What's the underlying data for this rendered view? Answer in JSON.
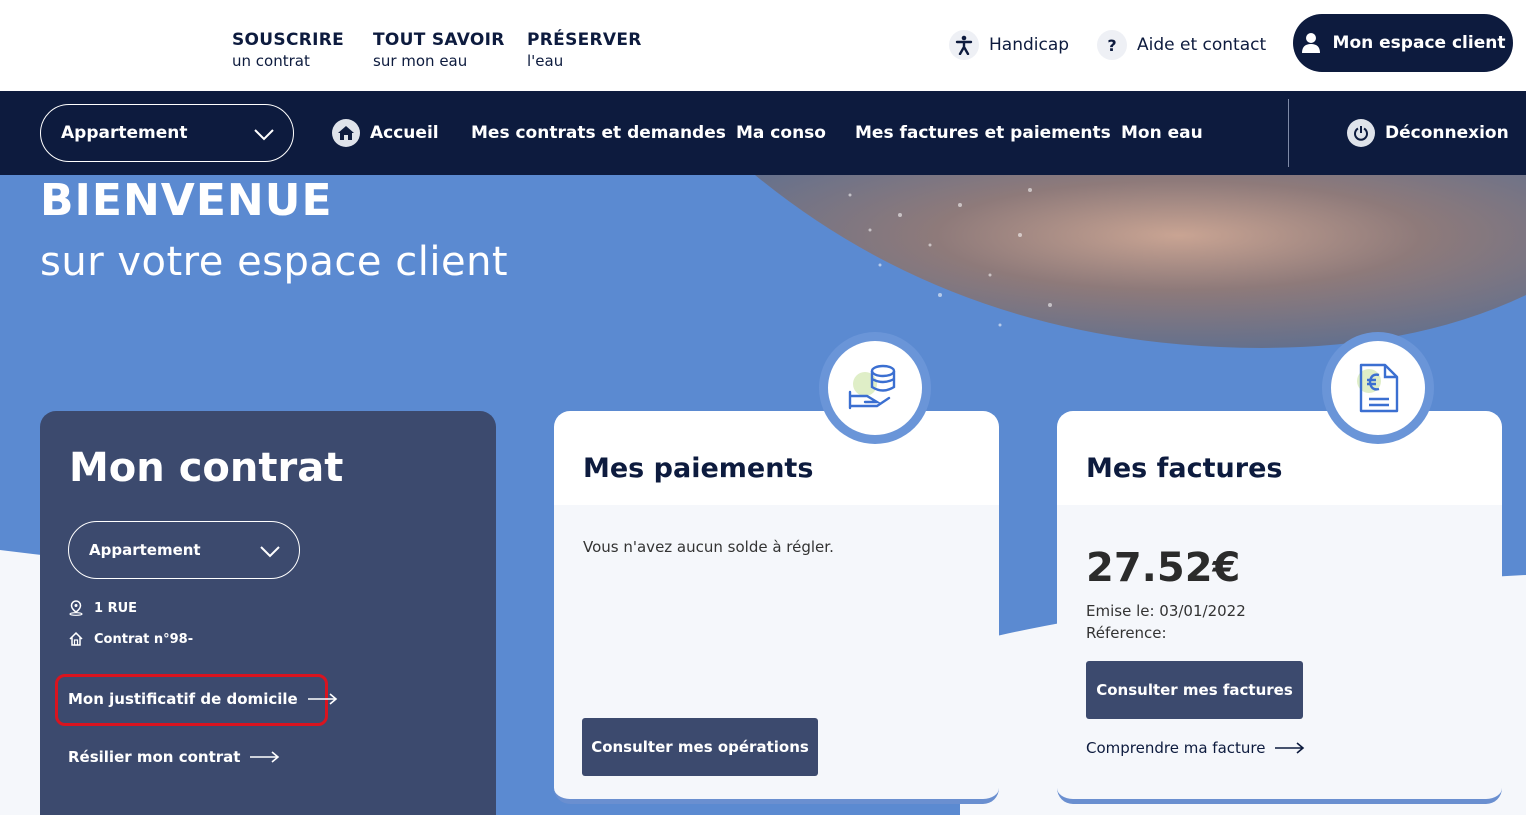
{
  "topbar": {
    "links": [
      {
        "line1": "SOUSCRIRE",
        "line2": "un contrat"
      },
      {
        "line1": "TOUT SAVOIR",
        "line2": "sur mon eau"
      },
      {
        "line1": "PRÉSERVER",
        "line2": "l'eau"
      }
    ],
    "handicap": "Handicap",
    "aide": "Aide et contact",
    "aide_icon_glyph": "?",
    "espace_client": "Mon espace client"
  },
  "nav": {
    "select_value": "Appartement",
    "items": [
      "Accueil",
      "Mes contrats et demandes",
      "Ma conso",
      "Mes factures et paiements",
      "Mon eau"
    ],
    "logout": "Déconnexion"
  },
  "hero": {
    "title": "BIENVENUE",
    "subtitle": "sur votre espace client"
  },
  "contrat": {
    "title": "Mon contrat",
    "select_value": "Appartement",
    "address": "1 RUE",
    "contract_number": "Contrat n°98-",
    "justificatif_link": "Mon justificatif de domicile",
    "resilier_link": "Résilier mon contrat"
  },
  "paiements": {
    "title": "Mes paiements",
    "message": "Vous n'avez aucun solde à régler.",
    "button": "Consulter mes opérations"
  },
  "factures": {
    "title": "Mes factures",
    "amount": "27.52€",
    "emise": "Emise le: 03/01/2022",
    "reference": "Réference:",
    "button": "Consulter mes factures",
    "link": "Comprendre ma facture"
  },
  "colors": {
    "navy": "#0d1b3e",
    "slate": "#3c4a6e",
    "hero_blue": "#5b8ad1",
    "highlight_red": "#d9141f"
  }
}
